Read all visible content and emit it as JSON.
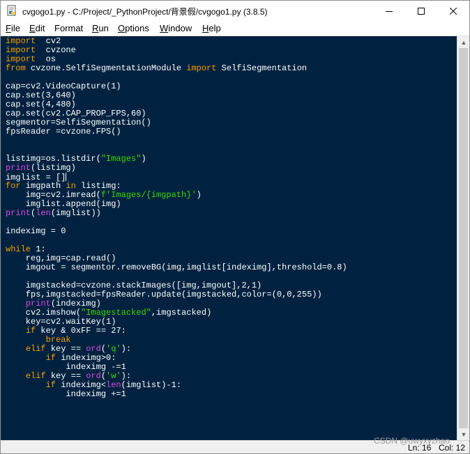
{
  "window": {
    "title": "cvgogo1.py - C:/Project/_PythonProject/背景假/cvgogo1.py (3.8.5)",
    "app_icon": "python-file-icon",
    "buttons": {
      "minimize": "minimize-icon",
      "maximize": "maximize-icon",
      "close": "close-icon"
    }
  },
  "menu": [
    {
      "label": "File",
      "underline": "F",
      "rest": "ile"
    },
    {
      "label": "Edit",
      "underline": "E",
      "rest": "dit"
    },
    {
      "label": "Format",
      "underline": "",
      "rest": "Format"
    },
    {
      "label": "Run",
      "underline": "R",
      "rest": "un"
    },
    {
      "label": "Options",
      "underline": "O",
      "rest": "ptions"
    },
    {
      "label": "Window",
      "underline": "W",
      "rest": "indow"
    },
    {
      "label": "Help",
      "underline": "H",
      "rest": "elp"
    }
  ],
  "editor": {
    "background": "#002240",
    "colors": {
      "keyword": "#ff9d00",
      "builtin": "#e047e0",
      "string": "#3ad900",
      "default": "#ffffff"
    },
    "lines": [
      [
        [
          "kw",
          "import"
        ],
        [
          "",
          "  cv2"
        ]
      ],
      [
        [
          "kw",
          "import"
        ],
        [
          "",
          "  cvzone"
        ]
      ],
      [
        [
          "kw",
          "import"
        ],
        [
          "",
          "  os"
        ]
      ],
      [
        [
          "kw",
          "from"
        ],
        [
          "",
          " cvzone.SelfiSegmentationModule "
        ],
        [
          "kw",
          "import"
        ],
        [
          "",
          " SelfiSegmentation"
        ]
      ],
      [],
      [
        [
          "",
          "cap=cv2.VideoCapture(1)"
        ]
      ],
      [
        [
          "",
          "cap.set(3,640)"
        ]
      ],
      [
        [
          "",
          "cap.set(4,480)"
        ]
      ],
      [
        [
          "",
          "cap.set(cv2.CAP_PROP_FPS,60)"
        ]
      ],
      [
        [
          "",
          "segmentor=SelfiSegmentation()"
        ]
      ],
      [
        [
          "",
          "fpsReader =cvzone.FPS()"
        ]
      ],
      [],
      [],
      [
        [
          "",
          "listimg=os.listdir("
        ],
        [
          "str",
          "\"Images\""
        ],
        [
          "",
          ")"
        ]
      ],
      [
        [
          "bi",
          "print"
        ],
        [
          "",
          "(listimg)"
        ]
      ],
      [
        [
          "",
          "imglist = []"
        ],
        [
          "cursor",
          ""
        ]
      ],
      [
        [
          "kw",
          "for"
        ],
        [
          "",
          " imgpath "
        ],
        [
          "kw",
          "in"
        ],
        [
          "",
          " listimg:"
        ]
      ],
      [
        [
          "",
          "    img=cv2.imread("
        ],
        [
          "str",
          "f'Images/{imgpath}'"
        ],
        [
          "",
          ")"
        ]
      ],
      [
        [
          "",
          "    imglist.append(img)"
        ]
      ],
      [
        [
          "bi",
          "print"
        ],
        [
          "",
          "("
        ],
        [
          "bi",
          "len"
        ],
        [
          "",
          "(imglist))"
        ]
      ],
      [],
      [
        [
          "",
          "indeximg = 0"
        ]
      ],
      [],
      [
        [
          "kw",
          "while"
        ],
        [
          "",
          " 1:"
        ]
      ],
      [
        [
          "",
          "    reg,img=cap.read()"
        ]
      ],
      [
        [
          "",
          "    imgout = segmentor.removeBG(img,imglist[indeximg],threshold=0.8)"
        ]
      ],
      [],
      [
        [
          "",
          "    imgstacked=cvzone.stackImages([img,imgout],2,1)"
        ]
      ],
      [
        [
          "",
          "    fps,imgstacked=fpsReader.update(imgstacked,color=(0,0,255))"
        ]
      ],
      [
        [
          "",
          "    "
        ],
        [
          "bi",
          "print"
        ],
        [
          "",
          "(indeximg)"
        ]
      ],
      [
        [
          "",
          "    cv2.imshow("
        ],
        [
          "str",
          "\"Imagestacked\""
        ],
        [
          "",
          ",imgstacked)"
        ]
      ],
      [
        [
          "",
          "    key=cv2.waitKey(1)"
        ]
      ],
      [
        [
          "",
          "    "
        ],
        [
          "kw",
          "if"
        ],
        [
          "",
          " key & 0xFF == 27:"
        ]
      ],
      [
        [
          "",
          "        "
        ],
        [
          "kw",
          "break"
        ]
      ],
      [
        [
          "",
          "    "
        ],
        [
          "kw",
          "elif"
        ],
        [
          "",
          " key == "
        ],
        [
          "bi",
          "ord"
        ],
        [
          "",
          "("
        ],
        [
          "str",
          "'q'"
        ],
        [
          "",
          "):"
        ]
      ],
      [
        [
          "",
          "        "
        ],
        [
          "kw",
          "if"
        ],
        [
          "",
          " indeximg>0:"
        ]
      ],
      [
        [
          "",
          "            indeximg -=1"
        ]
      ],
      [
        [
          "",
          "    "
        ],
        [
          "kw",
          "elif"
        ],
        [
          "",
          " key == "
        ],
        [
          "bi",
          "ord"
        ],
        [
          "",
          "("
        ],
        [
          "str",
          "'w'"
        ],
        [
          "",
          "):"
        ]
      ],
      [
        [
          "",
          "        "
        ],
        [
          "kw",
          "if"
        ],
        [
          "",
          " indeximg<"
        ],
        [
          "bi",
          "len"
        ],
        [
          "",
          "(imglist)-1:"
        ]
      ],
      [
        [
          "",
          "            indeximg +=1"
        ]
      ]
    ]
  },
  "status": {
    "line": "Ln: 16",
    "col": "Col: 12"
  },
  "watermark": "CSDN @uwyxyzhao"
}
